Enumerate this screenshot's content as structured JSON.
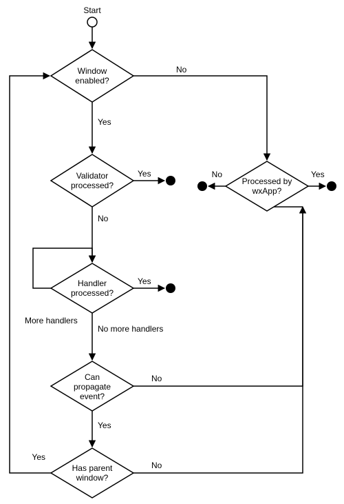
{
  "diagram": {
    "start": "Start",
    "nodes": {
      "window_enabled": "Window enabled?",
      "validator_processed": "Validator processed?",
      "handler_processed": "Handler processed?",
      "can_propagate": "Can propagate event?",
      "has_parent": "Has parent window?",
      "processed_by_wxapp": "Processed by wxApp?"
    },
    "edges": {
      "yes": "Yes",
      "no": "No",
      "more_handlers": "More handlers",
      "no_more_handlers": "No more handlers"
    }
  },
  "chart_data": {
    "type": "flowchart",
    "title": "",
    "nodes": [
      {
        "id": "start",
        "kind": "start",
        "label": "Start"
      },
      {
        "id": "window_enabled",
        "kind": "decision",
        "label": "Window enabled?"
      },
      {
        "id": "validator_processed",
        "kind": "decision",
        "label": "Validator processed?"
      },
      {
        "id": "handler_processed",
        "kind": "decision",
        "label": "Handler processed?"
      },
      {
        "id": "can_propagate",
        "kind": "decision",
        "label": "Can propagate event?"
      },
      {
        "id": "has_parent",
        "kind": "decision",
        "label": "Has parent window?"
      },
      {
        "id": "processed_by_wxapp",
        "kind": "decision",
        "label": "Processed by wxApp?"
      },
      {
        "id": "end_validator",
        "kind": "terminal"
      },
      {
        "id": "end_handler",
        "kind": "terminal"
      },
      {
        "id": "end_wxapp_yes",
        "kind": "terminal"
      },
      {
        "id": "end_wxapp_no",
        "kind": "terminal"
      }
    ],
    "edges": [
      {
        "from": "start",
        "to": "window_enabled"
      },
      {
        "from": "window_enabled",
        "to": "validator_processed",
        "label": "Yes"
      },
      {
        "from": "window_enabled",
        "to": "processed_by_wxapp",
        "label": "No"
      },
      {
        "from": "validator_processed",
        "to": "end_validator",
        "label": "Yes"
      },
      {
        "from": "validator_processed",
        "to": "handler_processed",
        "label": "No"
      },
      {
        "from": "handler_processed",
        "to": "end_handler",
        "label": "Yes"
      },
      {
        "from": "handler_processed",
        "to": "handler_processed",
        "label": "More handlers"
      },
      {
        "from": "handler_processed",
        "to": "can_propagate",
        "label": "No more handlers"
      },
      {
        "from": "can_propagate",
        "to": "has_parent",
        "label": "Yes"
      },
      {
        "from": "can_propagate",
        "to": "processed_by_wxapp",
        "label": "No"
      },
      {
        "from": "has_parent",
        "to": "window_enabled",
        "label": "Yes"
      },
      {
        "from": "has_parent",
        "to": "processed_by_wxapp",
        "label": "No"
      },
      {
        "from": "processed_by_wxapp",
        "to": "end_wxapp_yes",
        "label": "Yes"
      },
      {
        "from": "processed_by_wxapp",
        "to": "end_wxapp_no",
        "label": "No"
      }
    ]
  }
}
